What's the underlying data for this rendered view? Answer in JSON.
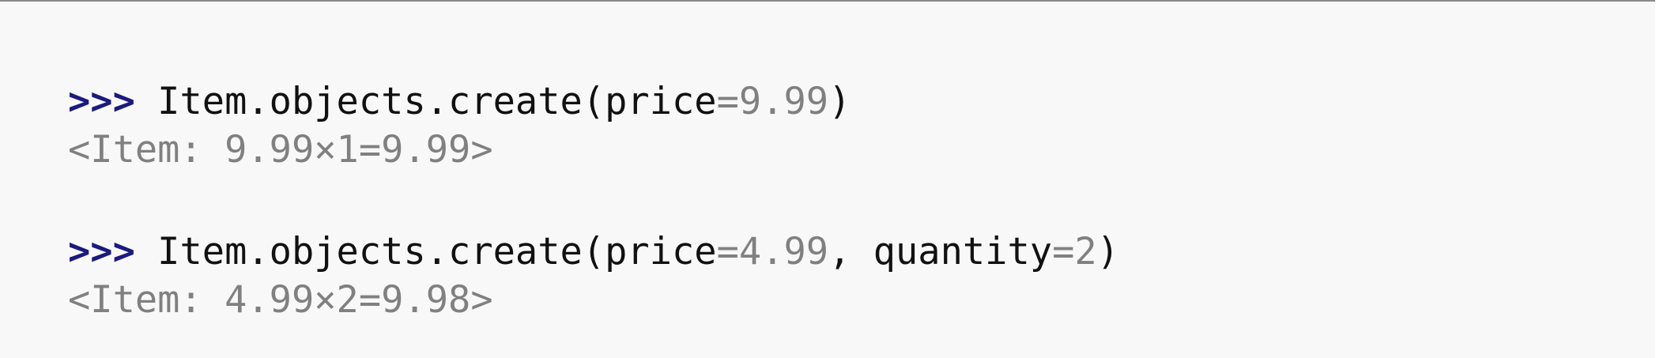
{
  "colors": {
    "background": "#f8f8f8",
    "prompt": "#1a1a80",
    "code_text": "#111111",
    "literal_and_output": "#808080"
  },
  "session": [
    {
      "prompt": ">>>",
      "code_before": " Item.objects.create(price",
      "eq1": "=",
      "price_value": "9.99",
      "code_after": ")",
      "output": "<Item: 9.99×1=9.99>"
    },
    {
      "prompt": ">>>",
      "code_before": " Item.objects.create(price",
      "eq1": "=",
      "price_value": "4.99",
      "sep": ", quantity",
      "eq2": "=",
      "quantity_value": "2",
      "code_after": ")",
      "output": "<Item: 4.99×2=9.98>"
    }
  ]
}
